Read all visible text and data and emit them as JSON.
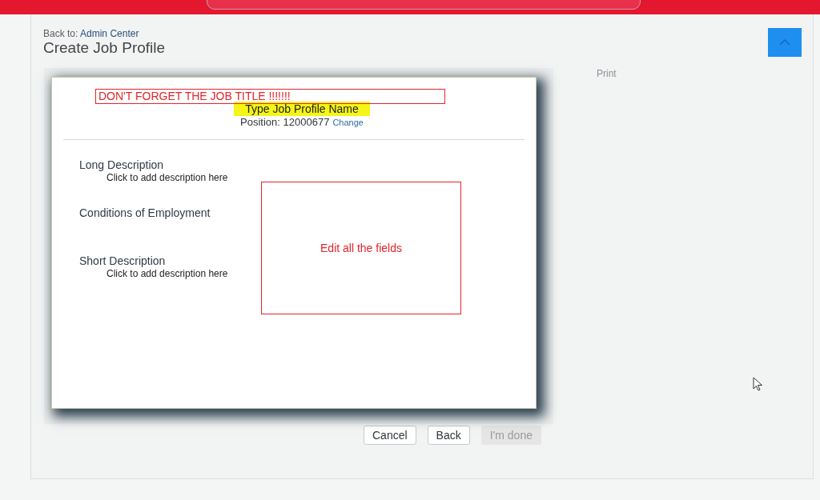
{
  "breadcrumb": {
    "prefix": "Back to:",
    "link": "Admin Center"
  },
  "page_title": "Create Job Profile",
  "side_actions": [
    "Print"
  ],
  "document": {
    "annotation": "DON'T FORGET THE JOB TITLE !!!!!!!",
    "profile_name": "Type Job Profile Name",
    "position_label": "Position:",
    "position_value": "12000677",
    "change_link": "Change",
    "sections": [
      {
        "title": "Long Description",
        "placeholder": "Click to add description here"
      },
      {
        "title": "Conditions of Employment"
      },
      {
        "title": "Short Description",
        "placeholder": "Click to add description here"
      }
    ],
    "note": "Edit all the fields"
  },
  "buttons": [
    {
      "label": "Cancel",
      "disabled": false
    },
    {
      "label": "Back",
      "disabled": false
    },
    {
      "label": "I'm done",
      "disabled": true
    }
  ]
}
